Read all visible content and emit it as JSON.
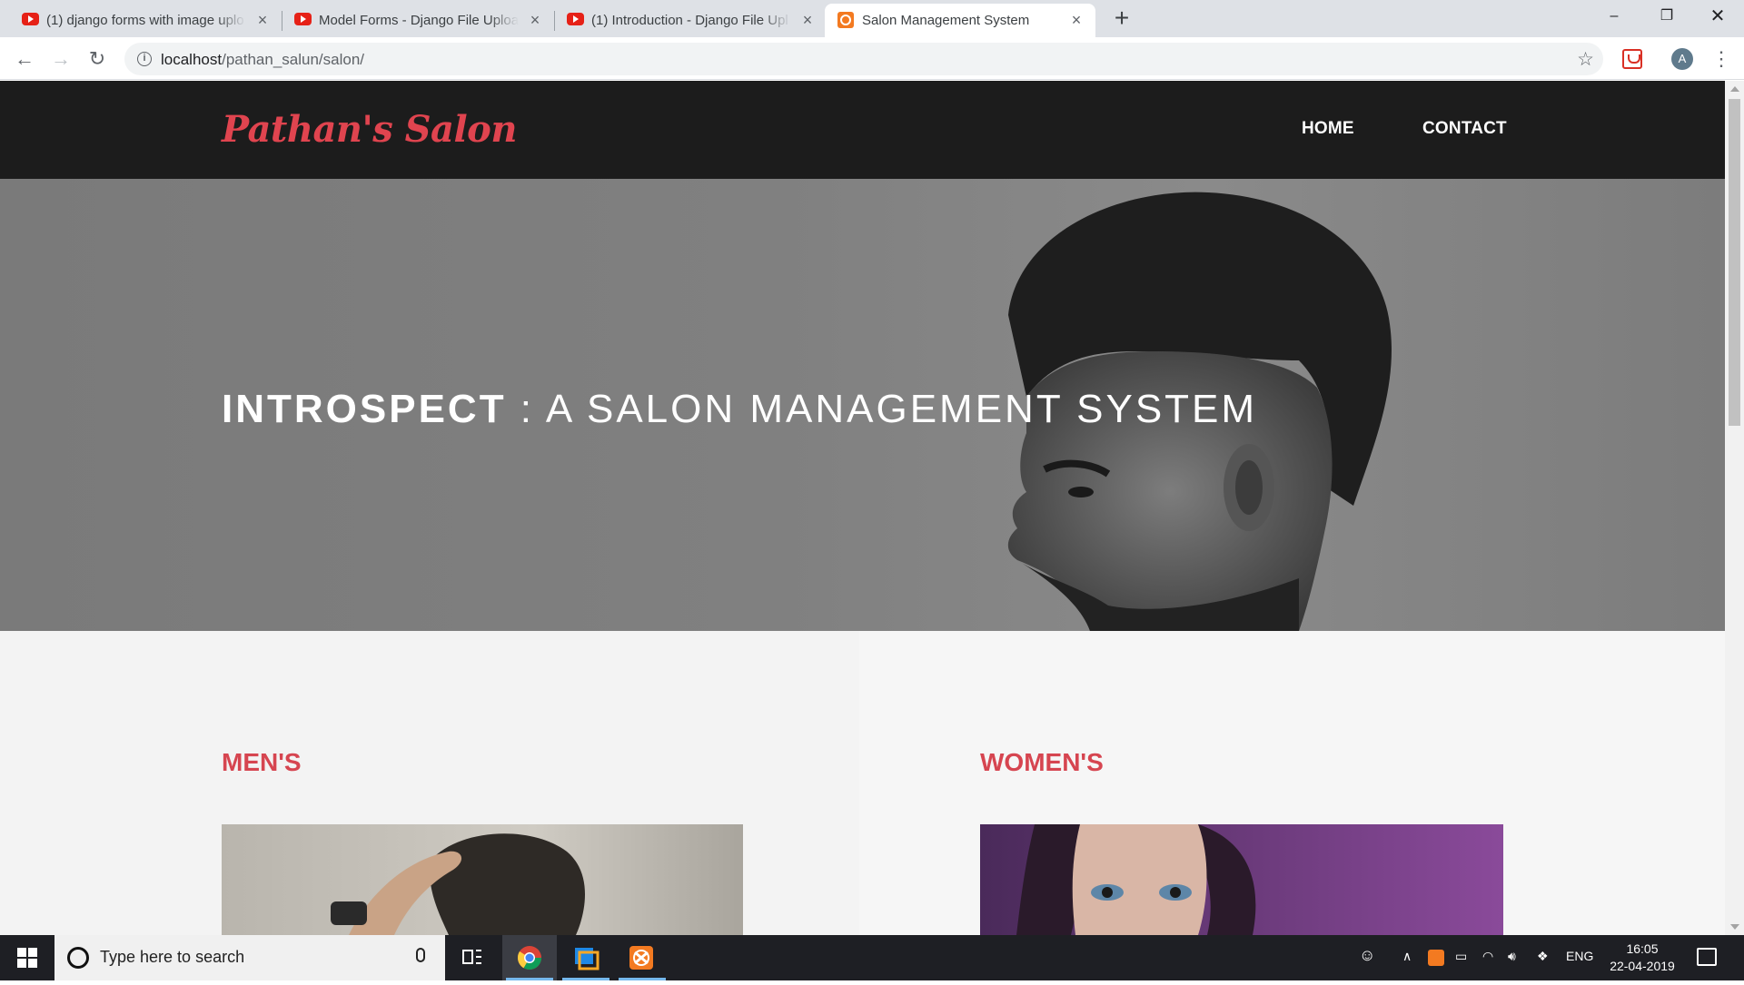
{
  "browser": {
    "tabs": [
      {
        "title": "(1) django forms with image uplo",
        "favicon": "youtube-icon",
        "active": false
      },
      {
        "title": "Model Forms - Django File Uploa",
        "favicon": "youtube-icon",
        "active": false
      },
      {
        "title": "(1) Introduction - Django File Upl",
        "favicon": "youtube-icon",
        "active": false
      },
      {
        "title": "Salon Management System",
        "favicon": "xampp-icon",
        "active": true
      }
    ],
    "url_host": "localhost",
    "url_path": "/pathan_salun/salon/",
    "profile_initial": "A"
  },
  "site": {
    "logo": "Pathan's Salon",
    "nav": {
      "home": "HOME",
      "contact": "CONTACT"
    },
    "hero": {
      "title_bold": "INTROSPECT",
      "title_rest": " : A SALON MANAGEMENT SYSTEM"
    },
    "sections": {
      "mens": "MEN'S",
      "womens": "WOMEN'S"
    },
    "colors": {
      "accent": "#e0444f",
      "header_bg": "#1c1c1c"
    }
  },
  "taskbar": {
    "search_placeholder": "Type here to search",
    "language": "ENG",
    "time": "16:05",
    "date": "22-04-2019"
  }
}
